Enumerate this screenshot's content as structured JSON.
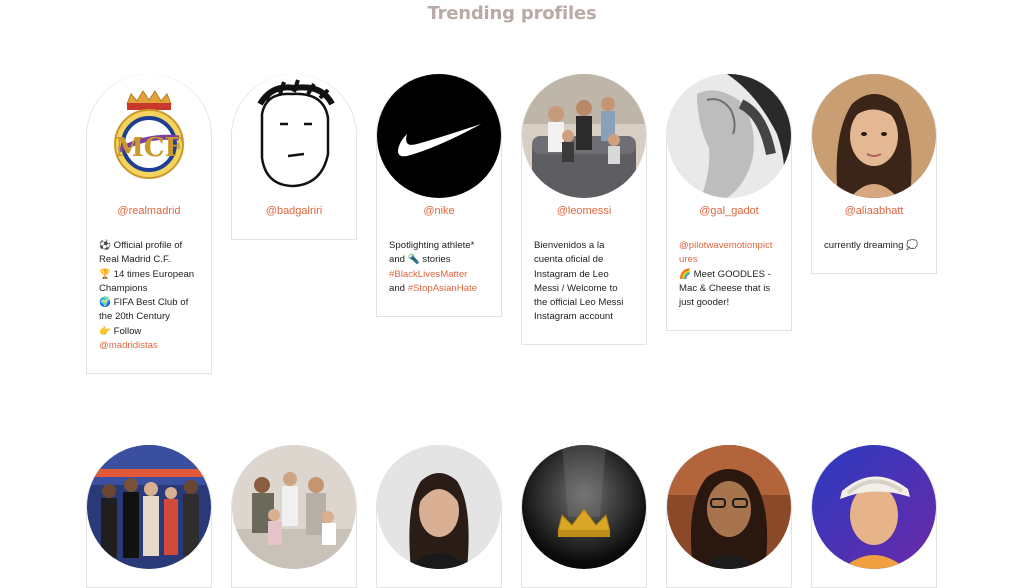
{
  "page": {
    "title": "Trending profiles"
  },
  "row1": [
    {
      "handle": "@realmadrid",
      "avatar": "real-madrid-crest-icon",
      "bio": [
        "⚽ Official profile of",
        "Real Madrid C.F.",
        "🏆 14 times European",
        "Champions",
        "🌍 FIFA Best Club of",
        "the 20th Century",
        "👉 Follow"
      ],
      "bio_link": "@madridistas"
    },
    {
      "handle": "@badgalriri",
      "avatar": "doodle-face-icon",
      "bio": []
    },
    {
      "handle": "@nike",
      "avatar": "nike-swoosh-icon",
      "bio": [
        "Spotlighting athlete*",
        "and 🔦 stories"
      ],
      "bio_links": [
        "#BlackLivesMatter",
        "#StopAsianHate"
      ],
      "bio_and": "and"
    },
    {
      "handle": "@leomessi",
      "avatar": "family-photo",
      "bio": [
        "Bienvenidos a la",
        "cuenta oficial de",
        "Instagram de Leo",
        "Messi / Welcome to",
        "the official Leo Messi",
        "Instagram account"
      ]
    },
    {
      "handle": "@gal_gadot",
      "avatar": "portrait-photo",
      "bio_link_lines": [
        "@pilotwavemotionpict",
        "ures"
      ],
      "bio": [
        "🌈 Meet GOODLES -",
        "Mac & Cheese that is",
        "just gooder!"
      ]
    },
    {
      "handle": "@aliaabhatt",
      "avatar": "portrait-photo",
      "bio": [
        "currently dreaming 💭"
      ]
    }
  ],
  "row2": [
    {
      "avatar": "group-photo"
    },
    {
      "avatar": "family-photo"
    },
    {
      "avatar": "portrait-photo"
    },
    {
      "avatar": "golden-crown-icon"
    },
    {
      "avatar": "portrait-photo"
    },
    {
      "avatar": "illustrated-portrait"
    }
  ],
  "colors": {
    "accent": "#e0663e",
    "title": "#b8aaa5",
    "border": "#e3e3e3"
  }
}
